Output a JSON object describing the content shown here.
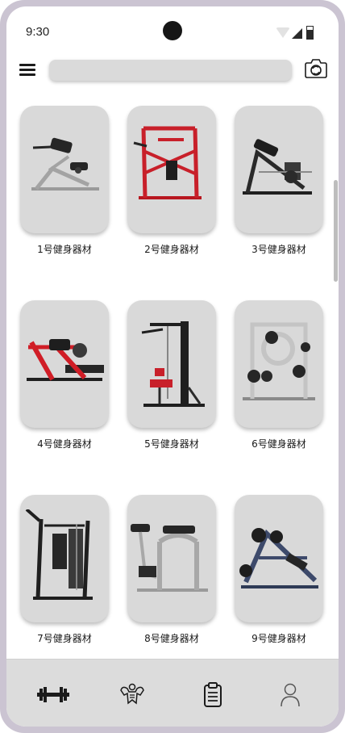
{
  "status_bar": {
    "time": "9:30",
    "icons": [
      "wifi-icon",
      "cellular-signal-icon",
      "battery-icon"
    ]
  },
  "top_bar": {
    "menu_icon": "hamburger-menu-icon",
    "search": {
      "value": "",
      "placeholder": ""
    },
    "camera_icon": "camera-scan-icon"
  },
  "equipment": [
    {
      "label": "1号健身器材",
      "accent": "#2a2a2a"
    },
    {
      "label": "2号健身器材",
      "accent": "#c8202a"
    },
    {
      "label": "3号健身器材",
      "accent": "#2a2a2a"
    },
    {
      "label": "4号健身器材",
      "accent": "#d01d26"
    },
    {
      "label": "5号健身器材",
      "accent": "#1f1f1f"
    },
    {
      "label": "6号健身器材",
      "accent": "#b9b9b9"
    },
    {
      "label": "7号健身器材",
      "accent": "#1f1f1f"
    },
    {
      "label": "8号健身器材",
      "accent": "#a8a8a8"
    },
    {
      "label": "9号健身器材",
      "accent": "#3d4a6b"
    }
  ],
  "bottom_nav": {
    "items": [
      {
        "icon": "dumbbell-icon"
      },
      {
        "icon": "muscle-body-icon"
      },
      {
        "icon": "clipboard-icon"
      },
      {
        "icon": "user-profile-icon"
      }
    ]
  },
  "colors": {
    "frame": "#cbc4d2",
    "card_background": "#d9d9d9",
    "nav_background": "#dcdcdc",
    "search_background": "#dadada"
  }
}
